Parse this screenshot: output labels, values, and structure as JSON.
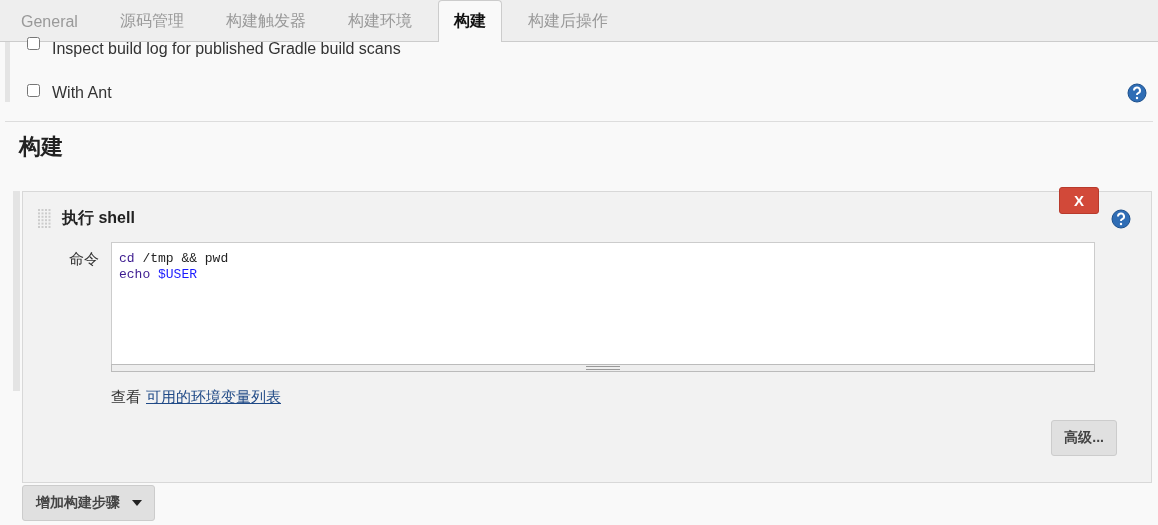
{
  "tabs": [
    {
      "label": "General",
      "selected": false
    },
    {
      "label": "源码管理",
      "selected": false
    },
    {
      "label": "构建触发器",
      "selected": false
    },
    {
      "label": "构建环境",
      "selected": false
    },
    {
      "label": "构建",
      "selected": true
    },
    {
      "label": "构建后操作",
      "selected": false
    }
  ],
  "options": [
    {
      "label": "Inspect build log for published Gradle build scans",
      "checked": false,
      "help": false
    },
    {
      "label": "With Ant",
      "checked": false,
      "help": true
    }
  ],
  "section_title": "构建",
  "build_step": {
    "title": "执行 shell",
    "delete_label": "X",
    "field_label": "命令",
    "code_lines": [
      [
        {
          "kind": "keyword",
          "text": "cd"
        },
        {
          "kind": "plain",
          "text": " /tmp && pwd"
        }
      ],
      [
        {
          "kind": "keyword",
          "text": "echo "
        },
        {
          "kind": "variable",
          "text": "$USER"
        }
      ]
    ],
    "hint_prefix": "查看",
    "hint_link": "可用的环境变量列表",
    "advanced_button": "高级..."
  },
  "add_step_button": "增加构建步骤"
}
